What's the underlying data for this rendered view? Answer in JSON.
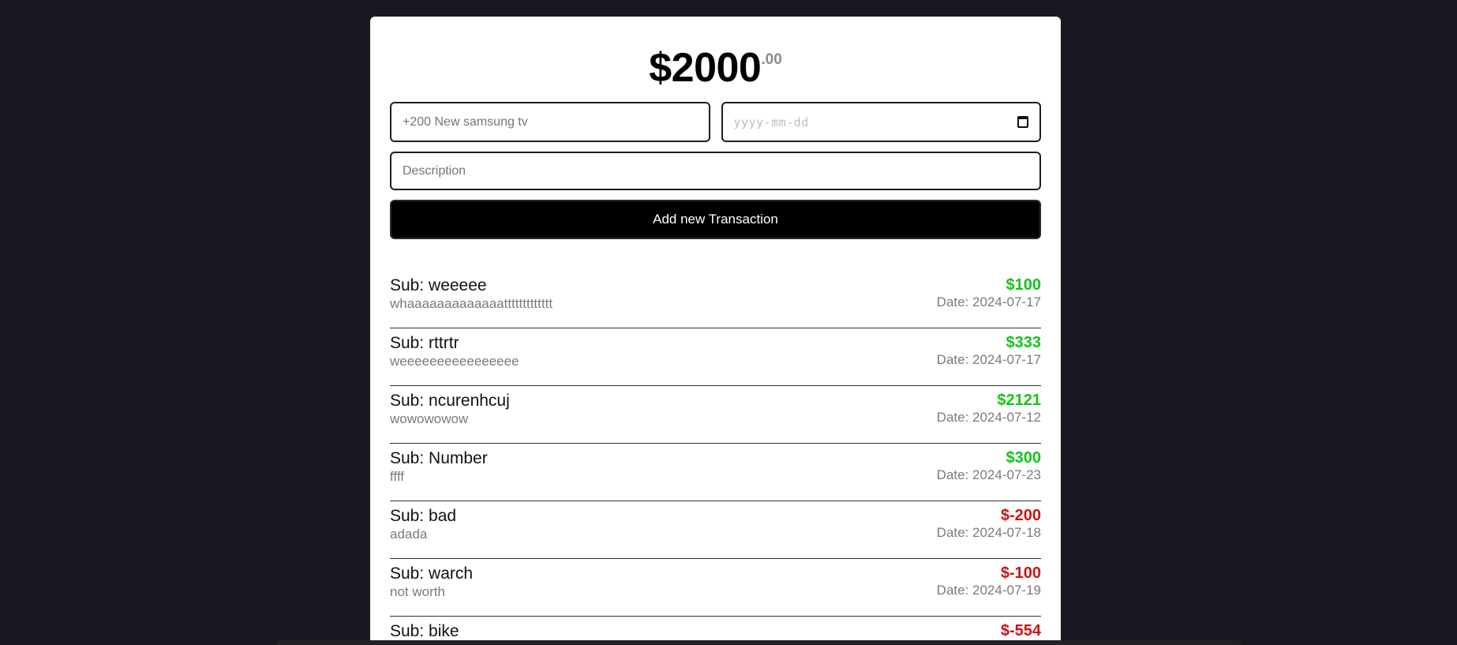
{
  "balance": {
    "main": "$2000",
    "cents": ".00"
  },
  "form": {
    "amount_placeholder": "+200 New samsung tv",
    "date_placeholder": "yyyy-mm-dd",
    "description_placeholder": "Description",
    "add_button_label": "Add new Transaction"
  },
  "transactions": [
    {
      "sub": "Sub: weeeee",
      "desc": "whaaaaaaaaaaaaattttttttttttt",
      "amount": "$100",
      "date": "Date: 2024-07-17",
      "sign": "pos"
    },
    {
      "sub": "Sub: rttrtr",
      "desc": "weeeeeeeeeeeeeeee",
      "amount": "$333",
      "date": "Date: 2024-07-17",
      "sign": "pos"
    },
    {
      "sub": "Sub: ncurenhcuj",
      "desc": "wowowowow",
      "amount": "$2121",
      "date": "Date: 2024-07-12",
      "sign": "pos"
    },
    {
      "sub": "Sub: Number",
      "desc": "ffff",
      "amount": "$300",
      "date": "Date: 2024-07-23",
      "sign": "pos"
    },
    {
      "sub": "Sub: bad",
      "desc": "adada",
      "amount": "$-200",
      "date": "Date: 2024-07-18",
      "sign": "neg"
    },
    {
      "sub": "Sub: warch",
      "desc": "not worth",
      "amount": "$-100",
      "date": "Date: 2024-07-19",
      "sign": "neg"
    },
    {
      "sub": "Sub: bike",
      "desc": "",
      "amount": "$-554",
      "date": "",
      "sign": "neg"
    }
  ],
  "colors": {
    "positive": "#17c21a",
    "negative": "#cc1414",
    "background": "#181820"
  }
}
